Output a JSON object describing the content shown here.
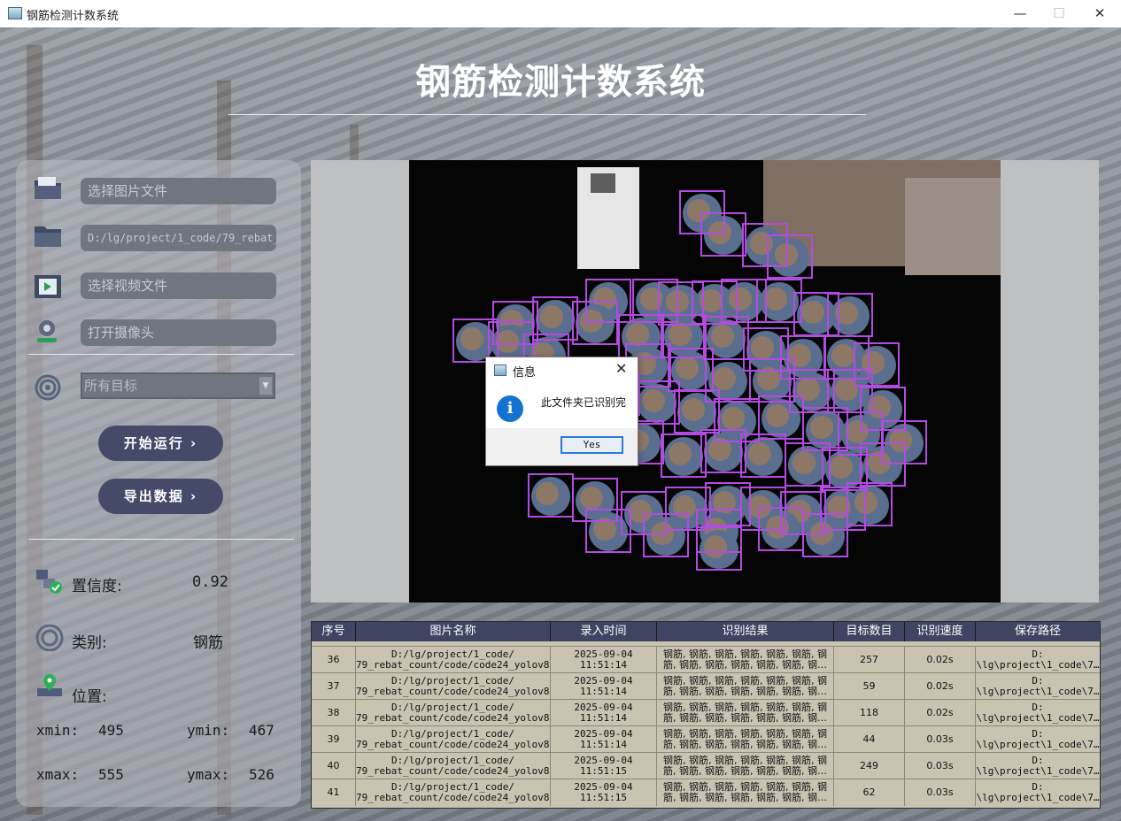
{
  "window": {
    "title": "钢筋检测计数系统",
    "icon": "app-window-icon"
  },
  "header": {
    "title": "钢筋检测计数系统"
  },
  "sidebar": {
    "image_file_placeholder": "选择图片文件",
    "folder_path": "D:/lg/project/1_code/79_rebat_count",
    "video_file_placeholder": "选择视频文件",
    "camera_label": "打开摄像头",
    "target_select": "所有目标",
    "run_button": "开始运行 ›",
    "export_button": "导出数据 ›",
    "confidence_label": "置信度:",
    "confidence_value": "0.92",
    "class_label": "类别:",
    "class_value": "钢筋",
    "position_label": "位置:",
    "xmin_label": "xmin:",
    "xmin": "495",
    "ymin_label": "ymin:",
    "ymin": "467",
    "xmax_label": "xmax:",
    "xmax": "555",
    "ymax_label": "ymax:",
    "ymax": "526"
  },
  "table": {
    "headers": [
      "序号",
      "图片名称",
      "录入时间",
      "识别结果",
      "目标数目",
      "识别速度",
      "保存路径"
    ],
    "rows": [
      {
        "id": "36",
        "name": "D:/lg/project/1_code/\n79_rebat_count/code/code24_yolov8…",
        "time": "2025-09-04\n11:51:14",
        "result": "钢筋, 钢筋, 钢筋, 钢筋, 钢筋, 钢筋, 钢\n筋, 钢筋, 钢筋, 钢筋, 钢筋, 钢筋, 钢…",
        "count": "257",
        "speed": "0.02s",
        "path": "D:\n\\lg\\project\\1_code\\7…"
      },
      {
        "id": "37",
        "name": "D:/lg/project/1_code/\n79_rebat_count/code/code24_yolov8…",
        "time": "2025-09-04\n11:51:14",
        "result": "钢筋, 钢筋, 钢筋, 钢筋, 钢筋, 钢筋, 钢\n筋, 钢筋, 钢筋, 钢筋, 钢筋, 钢筋, 钢…",
        "count": "59",
        "speed": "0.02s",
        "path": "D:\n\\lg\\project\\1_code\\7…"
      },
      {
        "id": "38",
        "name": "D:/lg/project/1_code/\n79_rebat_count/code/code24_yolov8…",
        "time": "2025-09-04\n11:51:14",
        "result": "钢筋, 钢筋, 钢筋, 钢筋, 钢筋, 钢筋, 钢\n筋, 钢筋, 钢筋, 钢筋, 钢筋, 钢筋, 钢…",
        "count": "118",
        "speed": "0.02s",
        "path": "D:\n\\lg\\project\\1_code\\7…"
      },
      {
        "id": "39",
        "name": "D:/lg/project/1_code/\n79_rebat_count/code/code24_yolov8…",
        "time": "2025-09-04\n11:51:14",
        "result": "钢筋, 钢筋, 钢筋, 钢筋, 钢筋, 钢筋, 钢\n筋, 钢筋, 钢筋, 钢筋, 钢筋, 钢筋, 钢…",
        "count": "44",
        "speed": "0.03s",
        "path": "D:\n\\lg\\project\\1_code\\7…"
      },
      {
        "id": "40",
        "name": "D:/lg/project/1_code/\n79_rebat_count/code/code24_yolov8…",
        "time": "2025-09-04\n11:51:15",
        "result": "钢筋, 钢筋, 钢筋, 钢筋, 钢筋, 钢筋, 钢\n筋, 钢筋, 钢筋, 钢筋, 钢筋, 钢筋, 钢…",
        "count": "249",
        "speed": "0.03s",
        "path": "D:\n\\lg\\project\\1_code\\7…"
      },
      {
        "id": "41",
        "name": "D:/lg/project/1_code/\n79_rebat_count/code/code24_yolov8…",
        "time": "2025-09-04\n11:51:15",
        "result": "钢筋, 钢筋, 钢筋, 钢筋, 钢筋, 钢筋, 钢\n筋, 钢筋, 钢筋, 钢筋, 钢筋, 钢筋, 钢…",
        "count": "62",
        "speed": "0.03s",
        "path": "D:\n\\lg\\project\\1_code\\7…"
      }
    ]
  },
  "dialog": {
    "title": "信息",
    "message": "此文件夹已识别完",
    "ok_label": "Yes"
  },
  "colors": {
    "accent": "#454a68",
    "table_header": "#3e4462",
    "box_color": "#b44be0",
    "info_blue": "#1473d0"
  }
}
